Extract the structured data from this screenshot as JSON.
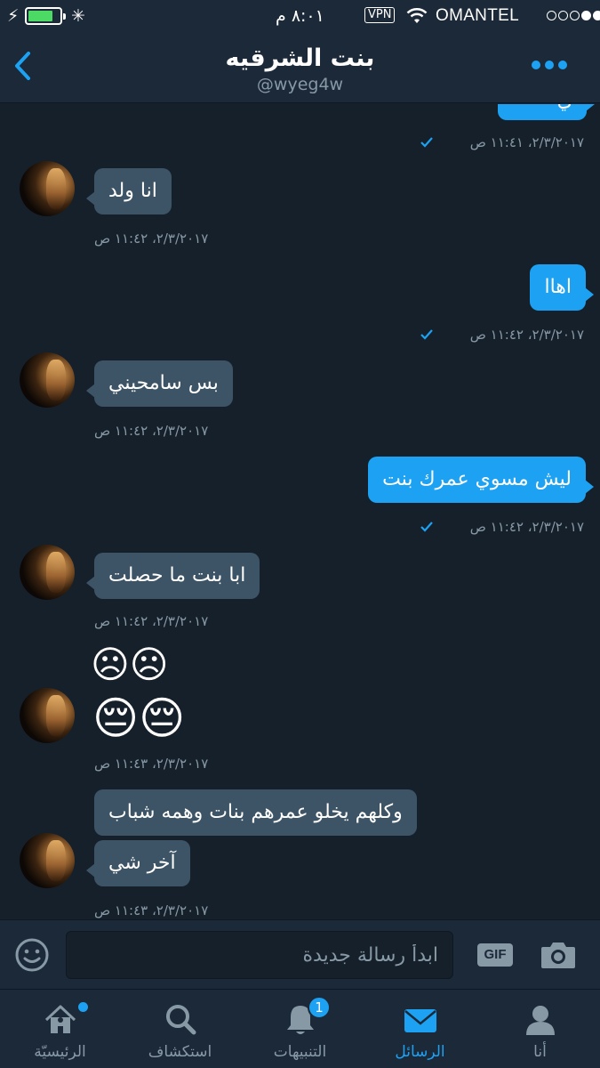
{
  "status_bar": {
    "time": "٨:٠١ م",
    "vpn": "VPN",
    "carrier": "OMANTEL",
    "battery_level": 0.8
  },
  "header": {
    "title": "بنت الشرقيه",
    "handle": "@wyeg4w"
  },
  "messages": [
    {
      "dir": "out",
      "text": "ي",
      "time": "٢/٣/٢٠١٧، ١١:٤١ ص"
    },
    {
      "dir": "in",
      "text": "انا ولد",
      "time": "٢/٣/٢٠١٧، ١١:٤٢ ص"
    },
    {
      "dir": "out",
      "text": "اهاا",
      "time": "٢/٣/٢٠١٧، ١١:٤٢ ص"
    },
    {
      "dir": "in",
      "text": "بس سامحيني",
      "time": "٢/٣/٢٠١٧، ١١:٤٢ ص"
    },
    {
      "dir": "out",
      "text": "ليش مسوي عمرك بنت",
      "time": "٢/٣/٢٠١٧، ١١:٤٢ ص"
    },
    {
      "dir": "in",
      "text": "ابا بنت ما حصلت",
      "time": "٢/٣/٢٠١٧، ١١:٤٢ ص"
    },
    {
      "dir": "in",
      "emoji_line1": "☹☹",
      "emoji_line2": "😔😔",
      "time": "٢/٣/٢٠١٧، ١١:٤٣ ص"
    },
    {
      "dir": "in",
      "text": "وكلهم يخلو عمرهم بنات وهمه شباب",
      "text2": "آخر شي",
      "time": "٢/٣/٢٠١٧، ١١:٤٣ ص"
    }
  ],
  "composer": {
    "placeholder": "ابدأ رسالة جديدة",
    "gif_label": "GIF"
  },
  "tabs": [
    {
      "label": "الرئيسيّة",
      "icon": "home-icon"
    },
    {
      "label": "استكشاف",
      "icon": "search-icon"
    },
    {
      "label": "التنبيهات",
      "icon": "bell-icon",
      "badge": "1"
    },
    {
      "label": "الرسائل",
      "icon": "envelope-icon",
      "active": true
    },
    {
      "label": "أنا",
      "icon": "person-icon"
    }
  ],
  "colors": {
    "accent": "#1da1f2",
    "background": "#15202b",
    "bar": "#1c2938",
    "incoming_bubble": "#3d5466"
  }
}
